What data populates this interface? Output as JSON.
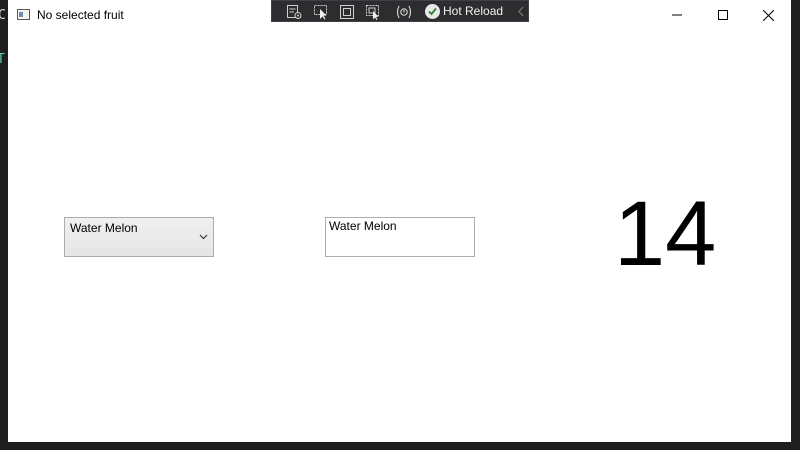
{
  "window": {
    "title": "No selected fruit"
  },
  "background_editor": {
    "fragment_top": "C",
    "fragment_mid": "T"
  },
  "hot_reload_toolbar": {
    "label": "Hot Reload",
    "icons": [
      "select-element-icon",
      "cursor-select-icon",
      "display-layout-adorner-icon",
      "track-focused-element-icon",
      "binding-failures-icon",
      "hot-reload-status-icon",
      "collapse-chevron-icon"
    ]
  },
  "fruit_combobox": {
    "selected_value": "Water Melon"
  },
  "fruit_textbox": {
    "value": "Water Melon"
  },
  "count_display": {
    "value": "14"
  },
  "colors": {
    "toolbar_bg": "#2d2d30",
    "editor_bg": "#1e1e1e",
    "window_bg": "#ffffff"
  }
}
